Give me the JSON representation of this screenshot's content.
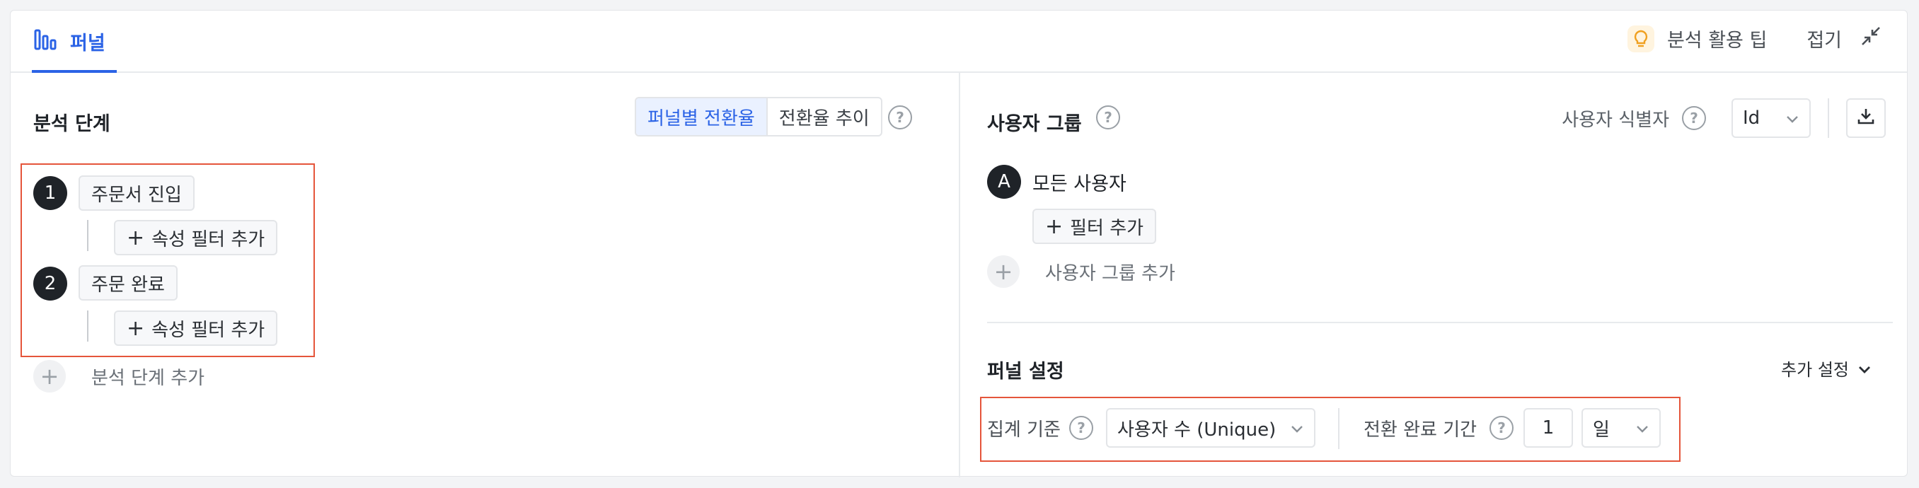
{
  "tab": {
    "label": "퍼널",
    "icon": "funnel-bars-icon"
  },
  "top": {
    "tip_label": "분석 활용 팁",
    "fold_label": "접기"
  },
  "left": {
    "title": "분석 단계",
    "toggle": {
      "active": "퍼널별 전환율",
      "inactive": "전환율 추이"
    },
    "steps": [
      {
        "number": "1",
        "name": "주문서 진입",
        "filter_label": "속성 필터 추가"
      },
      {
        "number": "2",
        "name": "주문 완료",
        "filter_label": "속성 필터 추가"
      }
    ],
    "add_step_label": "분석 단계 추가"
  },
  "right": {
    "title": "사용자 그룹",
    "identifier_label": "사용자 식별자",
    "identifier_value": "Id",
    "group": {
      "badge": "A",
      "name": "모든 사용자",
      "filter_label": "필터 추가"
    },
    "add_group_label": "사용자 그룹 추가",
    "settings": {
      "title": "퍼널 설정",
      "more_label": "추가 설정",
      "aggregation_label": "집계 기준",
      "aggregation_value": "사용자 수 (Unique)",
      "period_label": "전환 완료 기간",
      "period_value": "1",
      "period_unit": "일"
    }
  },
  "colors": {
    "accent": "#2b63e6",
    "highlight_box": "#e5553b"
  }
}
